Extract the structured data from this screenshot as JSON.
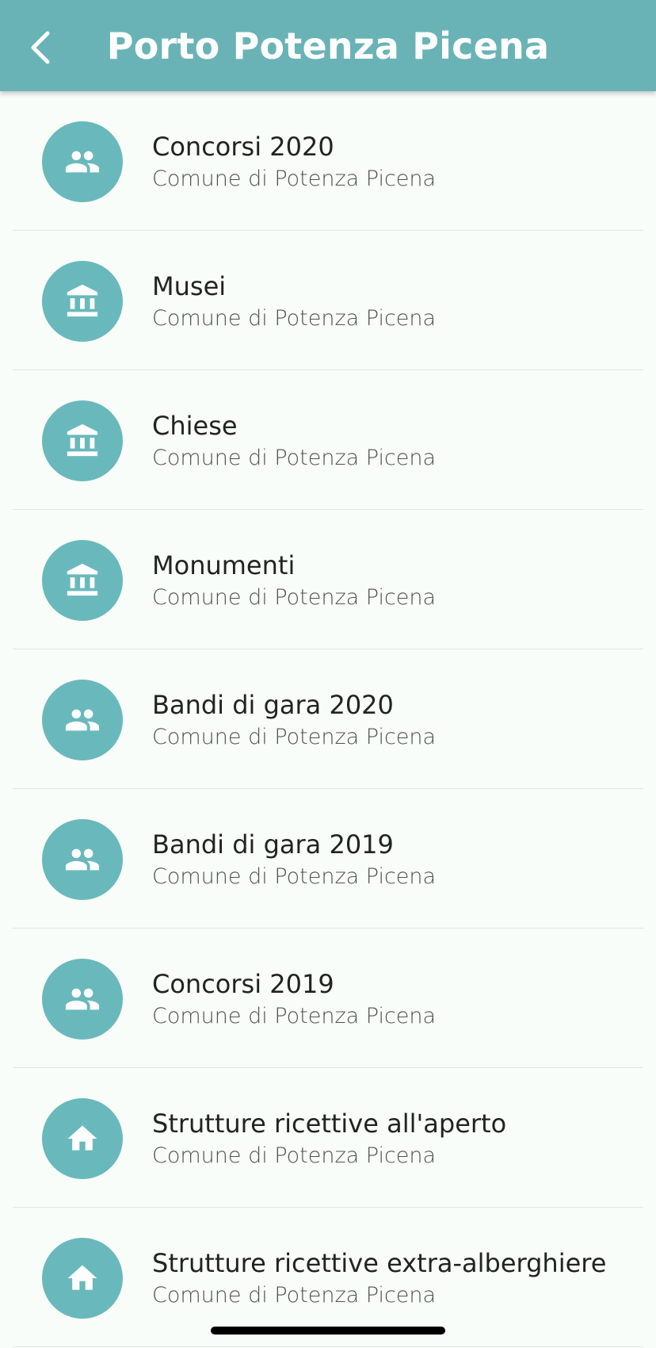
{
  "header": {
    "title": "Porto Potenza Picena",
    "back_icon": "chevron-left-icon"
  },
  "colors": {
    "accent": "#69b3b6",
    "avatar": "#69b9bc",
    "background": "#f8fdf9"
  },
  "items": [
    {
      "title": "Concorsi 2020",
      "subtitle": "Comune di Potenza Picena",
      "icon": "people-icon"
    },
    {
      "title": "Musei",
      "subtitle": "Comune di Potenza Picena",
      "icon": "museum-icon"
    },
    {
      "title": "Chiese",
      "subtitle": "Comune di Potenza Picena",
      "icon": "museum-icon"
    },
    {
      "title": "Monumenti",
      "subtitle": "Comune di Potenza Picena",
      "icon": "museum-icon"
    },
    {
      "title": "Bandi di gara 2020",
      "subtitle": "Comune di Potenza Picena",
      "icon": "people-icon"
    },
    {
      "title": "Bandi di gara 2019",
      "subtitle": "Comune di Potenza Picena",
      "icon": "people-icon"
    },
    {
      "title": "Concorsi 2019",
      "subtitle": "Comune di Potenza Picena",
      "icon": "people-icon"
    },
    {
      "title": "Strutture ricettive all'aperto",
      "subtitle": "Comune di Potenza Picena",
      "icon": "home-icon"
    },
    {
      "title": "Strutture ricettive extra-alberghiere",
      "subtitle": "Comune di Potenza Picena",
      "icon": "home-icon"
    }
  ]
}
